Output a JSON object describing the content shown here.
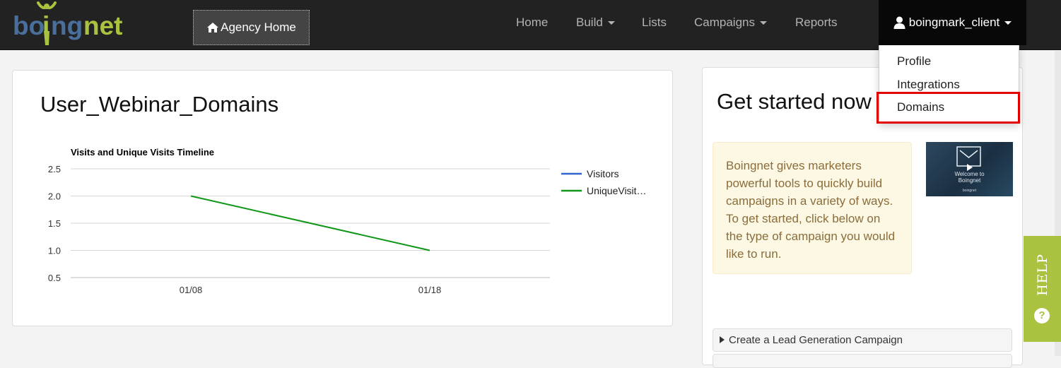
{
  "brand": {
    "logo_text": "boingnet",
    "logo_accent": "#a9c23f",
    "logo_blue": "#4a6f9c"
  },
  "navbar": {
    "agency_button": {
      "label": "Agency Home",
      "icon": "home-icon"
    },
    "items": [
      {
        "label": "Home",
        "has_caret": false
      },
      {
        "label": "Build",
        "has_caret": true
      },
      {
        "label": "Lists",
        "has_caret": false
      },
      {
        "label": "Campaigns",
        "has_caret": true
      },
      {
        "label": "Reports",
        "has_caret": false
      }
    ],
    "user": {
      "name": "boingmark_client",
      "icon": "user-icon"
    }
  },
  "user_dropdown": {
    "items": [
      {
        "label": "Profile"
      },
      {
        "label": "Integrations"
      },
      {
        "label": "Domains",
        "highlighted": true
      }
    ],
    "highlight_color": "#e00000"
  },
  "left_panel": {
    "title": "User_Webinar_Domains"
  },
  "chart_data": {
    "type": "line",
    "title": "Visits and Unique Visits Timeline",
    "x": [
      "01/08",
      "01/18"
    ],
    "series": [
      {
        "name": "Visitors",
        "values": [
          null,
          null
        ],
        "color": "#3366cc"
      },
      {
        "name": "UniqueVisit…",
        "values": [
          2.0,
          1.0
        ],
        "color": "#109618"
      }
    ],
    "y_ticks": [
      "2.5",
      "2.0",
      "1.5",
      "1.0",
      "0.5"
    ],
    "ylim": [
      0.5,
      2.5
    ],
    "grid": true,
    "legend_position": "right"
  },
  "right_panel": {
    "heading": "Get started now",
    "info_text": "Boingnet gives marketers powerful tools to quickly build campaigns in a variety of ways. To get started, click below on the type of campaign you would like to run.",
    "video": {
      "line1": "Welcome to",
      "line2": "Boingnet",
      "brand": "boingnet"
    },
    "accordion_label": "Create a Lead Generation Campaign"
  },
  "help_tab": {
    "label": "HELP",
    "icon_glyph": "?",
    "color": "#a9c23f"
  }
}
